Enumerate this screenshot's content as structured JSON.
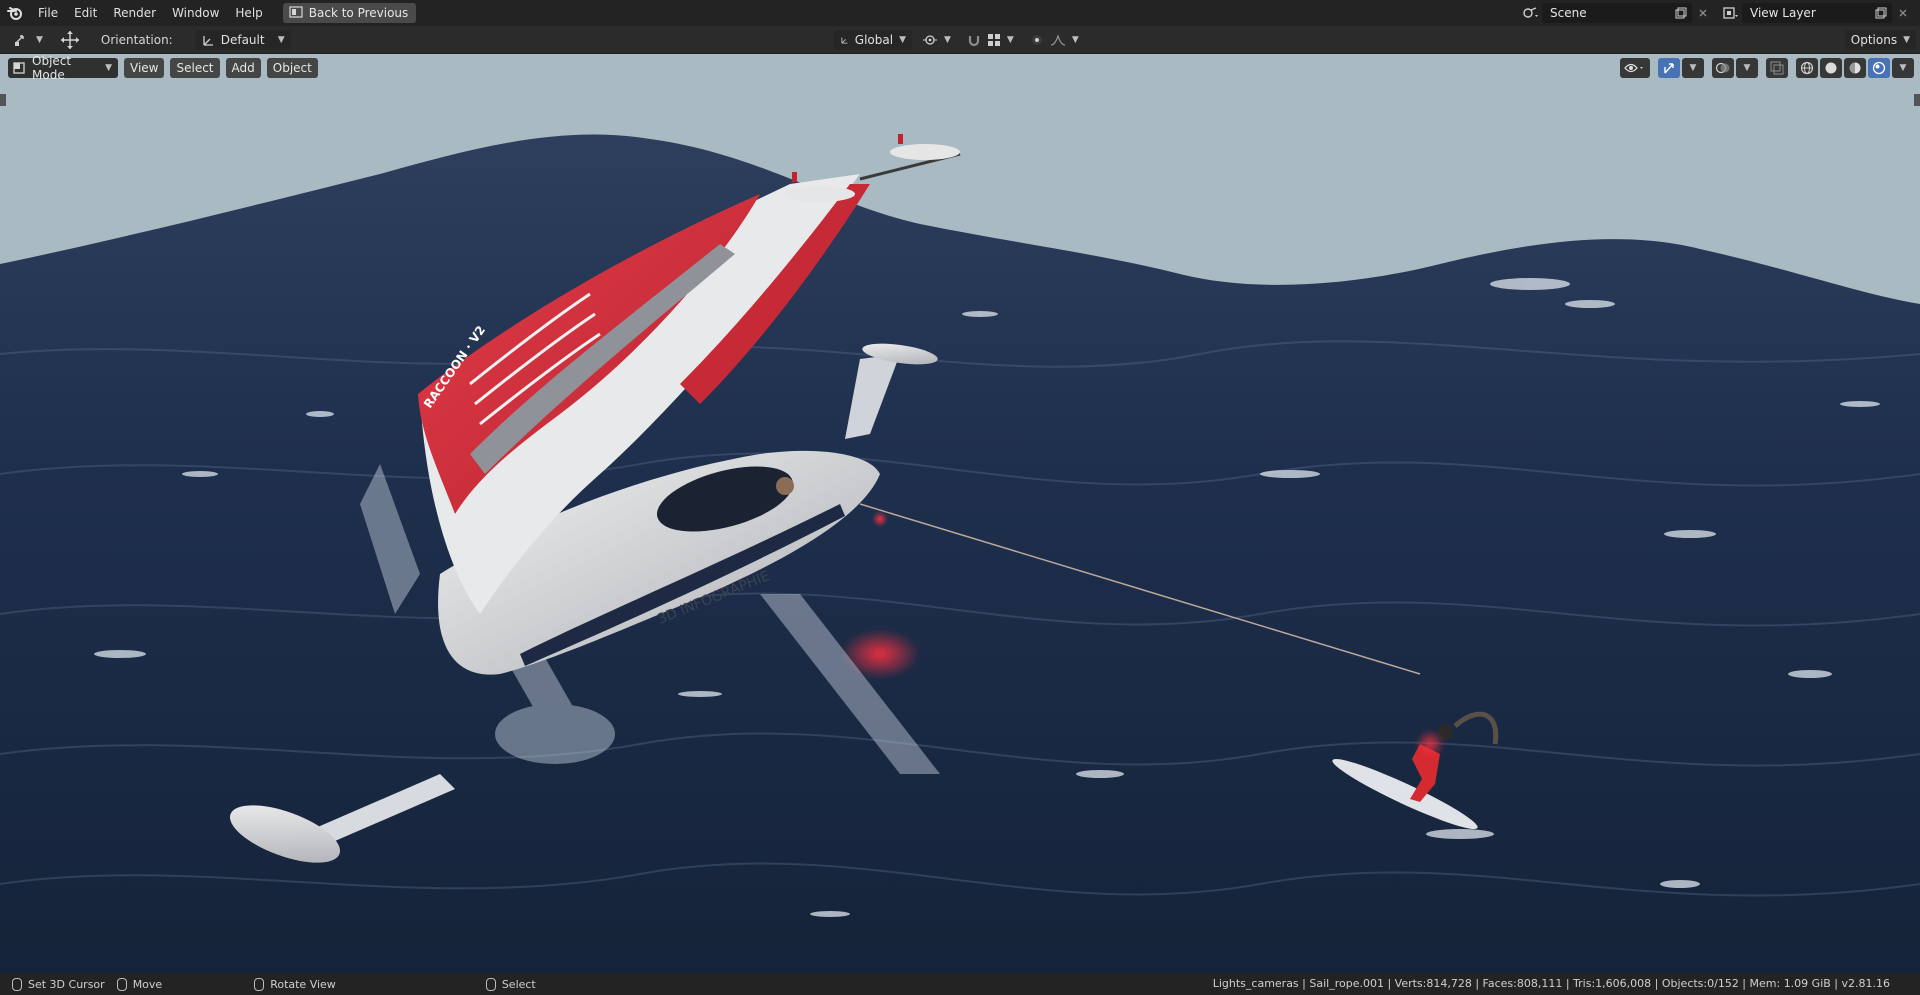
{
  "menubar": {
    "items": [
      "File",
      "Edit",
      "Render",
      "Window",
      "Help"
    ],
    "back_button": "Back to Previous",
    "scene_name": "Scene",
    "view_layer": "View Layer"
  },
  "toolheader": {
    "orientation_label": "Orientation:",
    "orientation_value": "Default",
    "transform_orientation": "Global",
    "options_label": "Options"
  },
  "viewport": {
    "mode": "Object Mode",
    "menus": [
      "View",
      "Select",
      "Add",
      "Object"
    ],
    "sail_text": "RACCOON · V2",
    "hull_text": "3D INFOGRAPHIE"
  },
  "statusbar": {
    "set_cursor": "Set 3D Cursor",
    "move": "Move",
    "rotate": "Rotate View",
    "select": "Select",
    "stats": "Lights_cameras | Sail_rope.001 | Verts:814,728 | Faces:808,111 | Tris:1,606,008 | Objects:0/152 | Mem: 1.09 GiB | v2.81.16"
  },
  "colors": {
    "ui_dark": "#232323",
    "header": "#2b2b2b",
    "accent_blue": "#4772b3",
    "sky": "#a9bac2",
    "sea": "#1c2c48",
    "sail_red": "#d8303c"
  },
  "icons": [
    "blender-logo-icon",
    "back-icon",
    "scene-icon",
    "view-layer-icon",
    "new-icon",
    "close-icon",
    "move-tool-icon",
    "transform-icon",
    "snap-icon",
    "pivot-icon",
    "proportional-icon",
    "visibility-icon",
    "gizmo-icon",
    "overlay-icon",
    "xray-icon",
    "wireframe-icon",
    "solid-icon",
    "material-icon",
    "rendered-icon",
    "mouse-icon"
  ]
}
